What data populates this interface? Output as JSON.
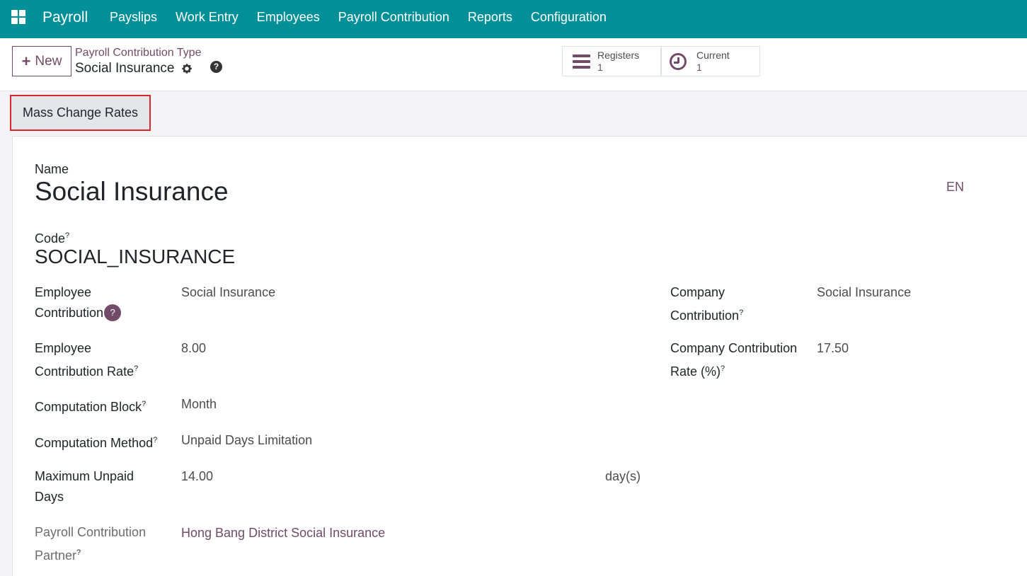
{
  "navbar": {
    "brand": "Payroll",
    "menu": [
      "Payslips",
      "Work Entry",
      "Employees",
      "Payroll Contribution",
      "Reports",
      "Configuration"
    ]
  },
  "control": {
    "new_label": "New",
    "breadcrumb": "Payroll Contribution Type",
    "record_title": "Social Insurance",
    "help_icon_glyph": "?",
    "stats": [
      {
        "label": "Registers",
        "value": "1",
        "icon": "list-icon"
      },
      {
        "label": "Current",
        "value": "1",
        "icon": "clock-icon"
      }
    ]
  },
  "actions": {
    "mass_change_label": "Mass Change Rates"
  },
  "form": {
    "name_label": "Name",
    "name_value": "Social Insurance",
    "lang": "EN",
    "code_label": "Code",
    "code_value": "SOCIAL_INSURANCE",
    "tooltip_mark": "?",
    "employee_contribution_label_1": "Employee",
    "employee_contribution_label_2": "Contribution",
    "employee_contribution_value": "Social Insurance",
    "company_contribution_label_1": "Company",
    "company_contribution_label_2": "Contribution",
    "company_contribution_value": "Social Insurance",
    "employee_rate_label_1": "Employee",
    "employee_rate_label_2": "Contribution Rate",
    "employee_rate_value": "8.00",
    "company_rate_label_1": "Company Contribution",
    "company_rate_label_2": "Rate (%)",
    "company_rate_value": "17.50",
    "computation_block_label": "Computation Block",
    "computation_block_value": "Month",
    "computation_method_label": "Computation Method",
    "computation_method_value": "Unpaid Days Limitation",
    "max_unpaid_label_1": "Maximum Unpaid",
    "max_unpaid_label_2": "Days",
    "max_unpaid_value": "14.00",
    "max_unpaid_unit": "day(s)",
    "partner_label_1": "Payroll Contribution",
    "partner_label_2": "Partner",
    "partner_value": "Hong Bang District Social Insurance"
  }
}
